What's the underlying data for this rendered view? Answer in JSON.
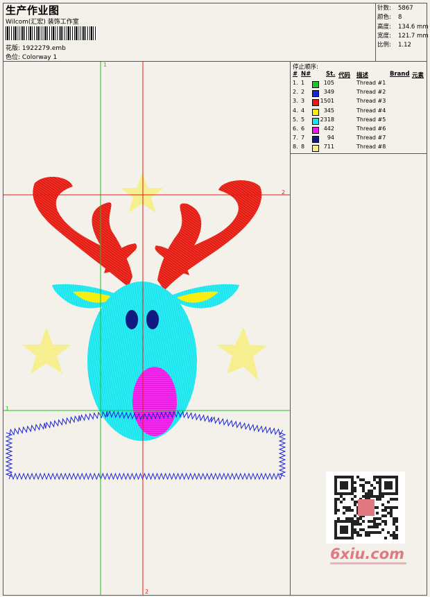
{
  "header": {
    "title": "生产作业图",
    "subtitle": "Wilcom(汇宏) 装饰工作室",
    "design_label": "花版:",
    "design_value": "1922279.emb",
    "colorway_label": "色位:",
    "colorway_value": "Colorway 1"
  },
  "stats": [
    {
      "label": "针数:",
      "value": "5867"
    },
    {
      "label": "颜色:",
      "value": "8"
    },
    {
      "label": "高度:",
      "value": "134.6 mm"
    },
    {
      "label": "宽度:",
      "value": "121.7 mm"
    },
    {
      "label": "比例:",
      "value": "1.12"
    }
  ],
  "threads": {
    "stop_title": "停止顺序:",
    "columns": {
      "num": "#",
      "n": "N#",
      "st": "St.",
      "code": "代码",
      "desc": "描述",
      "brand": "Brand",
      "element": "元素"
    },
    "rows": [
      {
        "num": "1.",
        "n": "1",
        "color": "#22c02a",
        "code": "105",
        "desc": "Thread #1"
      },
      {
        "num": "2.",
        "n": "2",
        "color": "#1a22d8",
        "code": "349",
        "desc": "Thread #2"
      },
      {
        "num": "3.",
        "n": "3",
        "color": "#e41b12",
        "code": "1501",
        "desc": "Thread #3"
      },
      {
        "num": "4.",
        "n": "4",
        "color": "#f8ee10",
        "code": "345",
        "desc": "Thread #4"
      },
      {
        "num": "5.",
        "n": "5",
        "color": "#18e6ee",
        "code": "2318",
        "desc": "Thread #5"
      },
      {
        "num": "6.",
        "n": "6",
        "color": "#ee18e6",
        "code": "442",
        "desc": "Thread #6"
      },
      {
        "num": "7.",
        "n": "7",
        "color": "#111a80",
        "code": "94",
        "desc": "Thread #7"
      },
      {
        "num": "8.",
        "n": "8",
        "color": "#f6ee8a",
        "code": "711",
        "desc": "Thread #8"
      }
    ]
  },
  "guides": {
    "v1": "1",
    "h1": "1",
    "v2": "2",
    "h2": "2"
  },
  "watermark": {
    "text": "6xiu.com"
  }
}
